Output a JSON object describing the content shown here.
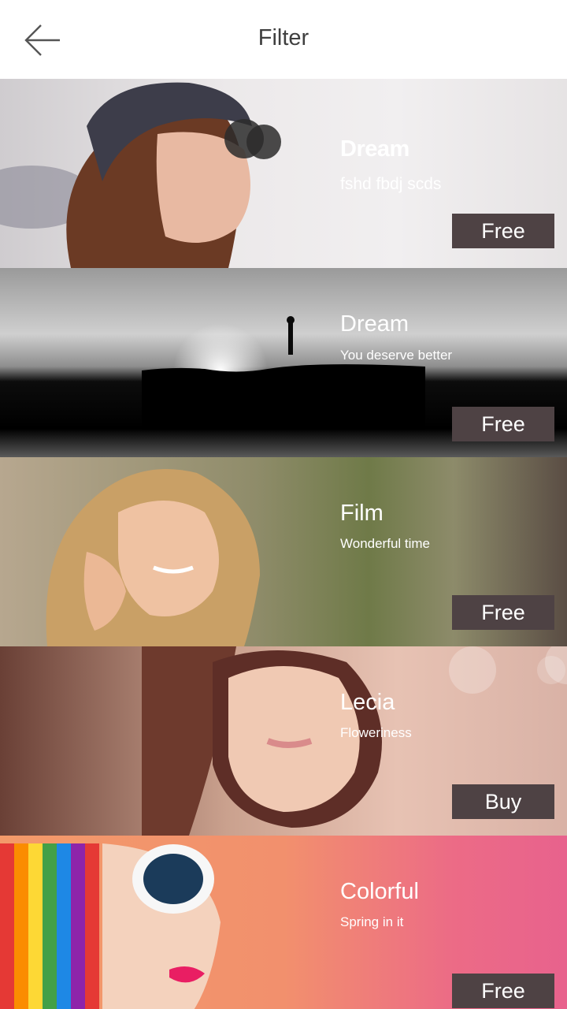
{
  "header": {
    "title": "Filter",
    "back_icon": "arrow-left-icon"
  },
  "filters": [
    {
      "name": "Dream",
      "subtitle": "fshd fbdj scds",
      "action": "Free"
    },
    {
      "name": "Dream",
      "subtitle": "You deserve better",
      "action": "Free"
    },
    {
      "name": "Film",
      "subtitle": "Wonderful time",
      "action": "Free"
    },
    {
      "name": "Lecia",
      "subtitle": "Floweriness",
      "action": "Buy"
    },
    {
      "name": "Colorful",
      "subtitle": "Spring in it",
      "action": "Free"
    }
  ],
  "colors": {
    "button_bg": "#4e4244",
    "title_text": "#3f3f3f",
    "card_text": "#ffffff"
  }
}
